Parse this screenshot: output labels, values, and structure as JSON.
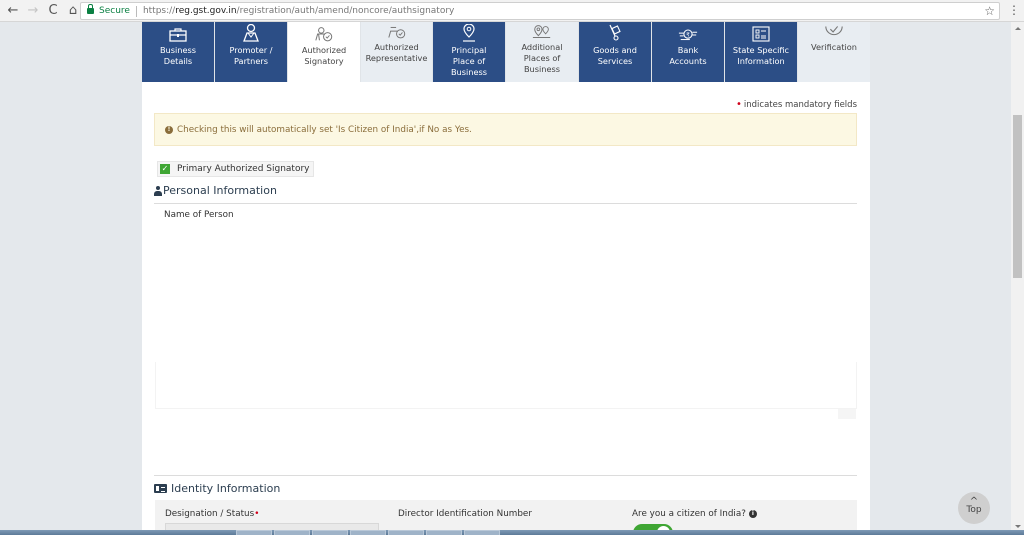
{
  "browser": {
    "back_label": "←",
    "forward_label": "→",
    "reload_label": "C",
    "home_label": "⌂",
    "secure_label": "Secure",
    "url_scheme": "https://",
    "url_host": "reg.gst.gov.in",
    "url_path": "/registration/auth/amend/noncore/authsignatory",
    "bookmark_icon": "☆",
    "menu_icon": "⋮"
  },
  "tabs": [
    {
      "label_1": "Business",
      "label_2": "Details",
      "label_3": "",
      "state": "done",
      "icon": "briefcase-icon"
    },
    {
      "label_1": "Promoter /",
      "label_2": "Partners",
      "label_3": "",
      "state": "done",
      "icon": "person-icon"
    },
    {
      "label_1": "Authorized",
      "label_2": "Signatory",
      "label_3": "",
      "state": "active",
      "icon": "person-check-icon"
    },
    {
      "label_1": "Authorized",
      "label_2": "Representative",
      "label_3": "",
      "state": "pending",
      "icon": "person-check-icon"
    },
    {
      "label_1": "Principal",
      "label_2": "Place of",
      "label_3": "Business",
      "state": "done",
      "icon": "map-pin-icon"
    },
    {
      "label_1": "Additional",
      "label_2": "Places of",
      "label_3": "Business",
      "state": "pending",
      "icon": "map-pins-icon"
    },
    {
      "label_1": "Goods and",
      "label_2": "Services",
      "label_3": "",
      "state": "done",
      "icon": "hand-truck-icon"
    },
    {
      "label_1": "Bank",
      "label_2": "Accounts",
      "label_3": "",
      "state": "done",
      "icon": "rupee-coin-icon"
    },
    {
      "label_1": "State Specific",
      "label_2": "Information",
      "label_3": "",
      "state": "done",
      "icon": "list-icon"
    },
    {
      "label_1": "Verification",
      "label_2": "",
      "label_3": "",
      "state": "pending",
      "icon": "check-circle-icon"
    }
  ],
  "form": {
    "mandatory_note": "indicates mandatory fields",
    "alert_text": "Checking this will automatically set 'Is Citizen of India',if No as Yes.",
    "primary_signatory": {
      "label": "Primary Authorized Signatory",
      "checked": true
    },
    "personal_section_title": "Personal Information",
    "name_of_person_label": "Name of Person",
    "identity_section_title": "Identity Information",
    "designation_label": "Designation / Status",
    "din_label": "Director Identification Number",
    "citizen_label": "Are you a citizen of India?",
    "citizen_value": true
  },
  "top_button_label": "Top",
  "colors": {
    "tab_done": "#2c4e86",
    "tab_pending": "#e8edf2",
    "alert_bg": "#fcf8e3",
    "checkbox": "#3fa634",
    "required": "#d0021b"
  }
}
